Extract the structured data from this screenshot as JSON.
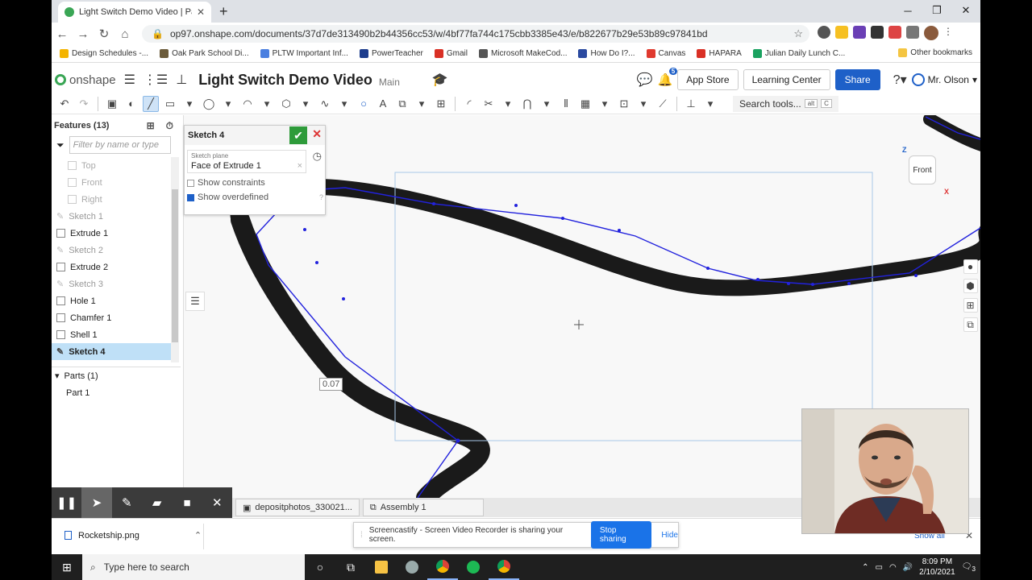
{
  "browser": {
    "tab_title": "Light Switch Demo Video | Part S",
    "tab_close": "✕",
    "new_tab": "+",
    "url": "op97.onshape.com/documents/37d7de313490b2b44356cc53/w/4bf77fa744c175cbb3385e43/e/b822677b29e53b89c97841bd",
    "window_controls": [
      "─",
      "❐",
      "✕"
    ],
    "nav": {
      "back": "←",
      "forward": "→",
      "reload": "↻",
      "home": "⌂"
    },
    "bookmarks": [
      {
        "label": "Design Schedules -...",
        "color": "#f4b400"
      },
      {
        "label": "Oak Park School Di...",
        "color": "#6b5b3a"
      },
      {
        "label": "PLTW Important Inf...",
        "color": "#4a7fe0"
      },
      {
        "label": "PowerTeacher",
        "color": "#1c3c8c"
      },
      {
        "label": "Gmail",
        "color": "#d93025"
      },
      {
        "label": "Microsoft MakeCod...",
        "color": "#555555"
      },
      {
        "label": "How Do I?...",
        "color": "#2b4aa0"
      },
      {
        "label": "Canvas",
        "color": "#e03a2f"
      },
      {
        "label": "HAPARA",
        "color": "#d93025"
      },
      {
        "label": "Julian Daily Lunch C...",
        "color": "#1aa260"
      }
    ],
    "other_bookmarks": "Other bookmarks"
  },
  "onshape": {
    "logo_text": "onshape",
    "doc_title": "Light Switch Demo Video",
    "branch": "Main",
    "notification_count": "5",
    "app_store": "App Store",
    "learning_center": "Learning Center",
    "share": "Share",
    "user": "Mr. Olson",
    "search_tools": "Search tools...",
    "search_kbd_alt": "alt",
    "search_kbd_c": "C"
  },
  "features": {
    "header": "Features (13)",
    "filter_placeholder": "Filter by name or type",
    "planes": [
      "Top",
      "Front",
      "Right"
    ],
    "items": [
      {
        "label": "Sketch 1",
        "state": "dim"
      },
      {
        "label": "Extrude 1",
        "state": "normal"
      },
      {
        "label": "Sketch 2",
        "state": "dim"
      },
      {
        "label": "Extrude 2",
        "state": "normal"
      },
      {
        "label": "Sketch 3",
        "state": "dim"
      },
      {
        "label": "Hole 1",
        "state": "normal"
      },
      {
        "label": "Chamfer 1",
        "state": "normal"
      },
      {
        "label": "Shell 1",
        "state": "normal"
      },
      {
        "label": "Sketch 4",
        "state": "selected"
      }
    ],
    "parts_header": "Parts (1)",
    "parts": [
      "Part 1"
    ]
  },
  "sketch_dialog": {
    "title": "Sketch 4",
    "plane_label": "Sketch plane",
    "plane_value": "Face of Extrude 1",
    "show_constraints": "Show constraints",
    "show_constraints_checked": false,
    "show_overdefined": "Show overdefined",
    "show_overdefined_checked": true
  },
  "viewport": {
    "dimension": "0.07",
    "viewcube_face": "Front",
    "axis_z": "Z",
    "axis_x": "X"
  },
  "bottom_tabs": [
    "depositphotos_330021...",
    "Assembly 1"
  ],
  "download": {
    "file": "Rocketship.png",
    "show_all": "Show all"
  },
  "share_notice": {
    "text": "Screencastify - Screen Video Recorder is sharing your screen.",
    "stop": "Stop sharing",
    "hide": "Hide"
  },
  "taskbar": {
    "search_placeholder": "Type here to search",
    "time": "8:09 PM",
    "date": "2/10/2021",
    "notification_count": "3"
  },
  "colors": {
    "accent": "#1e60c8",
    "sketch_line": "#2222dd",
    "onshape_green": "#3aa655",
    "selected_row": "#bfe0f7"
  }
}
